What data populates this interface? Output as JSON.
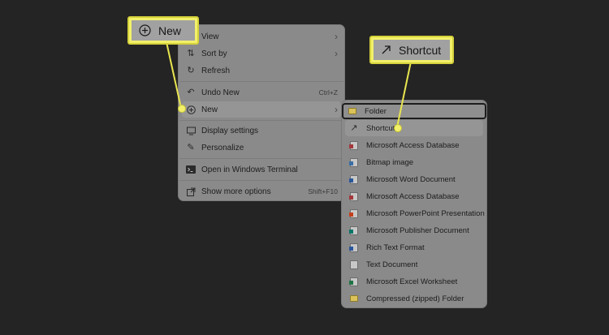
{
  "context_menu": {
    "items": [
      {
        "label": "View",
        "icon": "grid-icon",
        "submenu": true
      },
      {
        "label": "Sort by",
        "icon": "sort-icon",
        "submenu": true
      },
      {
        "label": "Refresh",
        "icon": "refresh-icon"
      },
      {
        "label": "Undo New",
        "icon": "undo-icon",
        "shortcut": "Ctrl+Z"
      },
      {
        "label": "New",
        "icon": "plus-circle-icon",
        "submenu": true
      },
      {
        "label": "Display settings",
        "icon": "display-icon"
      },
      {
        "label": "Personalize",
        "icon": "brush-icon"
      },
      {
        "label": "Open in Windows Terminal",
        "icon": "terminal-icon"
      },
      {
        "label": "Show more options",
        "icon": "share-icon",
        "shortcut": "Shift+F10"
      }
    ]
  },
  "new_submenu": {
    "items": [
      {
        "label": "Folder",
        "icon": "folder-icon"
      },
      {
        "label": "Shortcut",
        "icon": "shortcut-icon"
      },
      {
        "label": "Microsoft Access Database",
        "icon": "access-file-icon",
        "color": "#a4373a"
      },
      {
        "label": "Bitmap image",
        "icon": "bitmap-file-icon",
        "color": "#3a6ea5"
      },
      {
        "label": "Microsoft Word Document",
        "icon": "word-file-icon",
        "color": "#2b579a"
      },
      {
        "label": "Microsoft Access Database",
        "icon": "access-file-icon",
        "color": "#a4373a"
      },
      {
        "label": "Microsoft PowerPoint Presentation",
        "icon": "powerpoint-file-icon",
        "color": "#c43e1c"
      },
      {
        "label": "Microsoft Publisher Document",
        "icon": "publisher-file-icon",
        "color": "#077568"
      },
      {
        "label": "Rich Text Format",
        "icon": "rtf-file-icon",
        "color": "#2b579a"
      },
      {
        "label": "Text Document",
        "icon": "text-file-icon"
      },
      {
        "label": "Microsoft Excel Worksheet",
        "icon": "excel-file-icon",
        "color": "#217346"
      },
      {
        "label": "Compressed (zipped) Folder",
        "icon": "zip-folder-icon"
      }
    ]
  },
  "callouts": {
    "new_label": "New",
    "shortcut_label": "Shortcut"
  },
  "colors": {
    "background": "#242424",
    "menu": "#8a8a8a",
    "highlight_callout": "#f2f06a"
  }
}
